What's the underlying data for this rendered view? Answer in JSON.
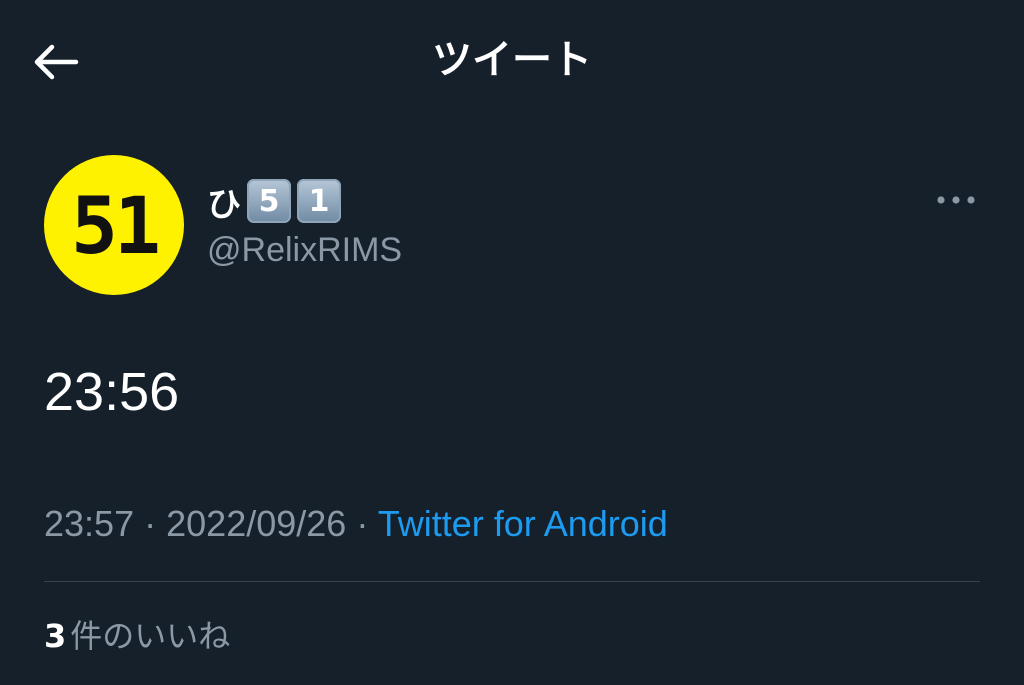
{
  "header": {
    "title": "ツイート",
    "back_icon": "arrow-left-icon"
  },
  "tweet": {
    "author": {
      "avatar_text": "51",
      "name": "ひ",
      "name_badges": [
        "5",
        "1"
      ],
      "handle": "@RelixRIMS"
    },
    "more_icon": "more-horizontal-icon",
    "text": "23:56",
    "time": "23:57",
    "date": "2022/09/26",
    "separator": "·",
    "source": "Twitter for Android",
    "likes_count": "3",
    "likes_label": "件のいいね"
  },
  "colors": {
    "background": "#15202b",
    "primary_text": "#ffffff",
    "secondary_text": "#8b98a5",
    "link": "#1d9bf0",
    "divider": "#38444d",
    "avatar_bg": "#fff200"
  }
}
